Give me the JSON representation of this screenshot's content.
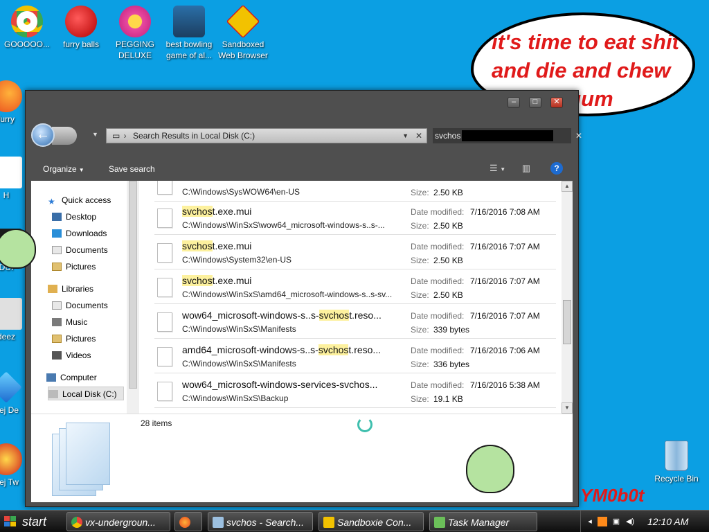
{
  "desktop_icons": [
    {
      "label": "GOOOOO...",
      "color": "#e8453c"
    },
    {
      "label": "furry balls",
      "color": "#d62020"
    },
    {
      "label": "PEGGING DELUXE",
      "color": "#e84aa0"
    },
    {
      "label": "best bowling game of al...",
      "color": "#3aa850"
    },
    {
      "label": "Sandboxed Web Browser",
      "color": "#f2c200"
    }
  ],
  "left_edge_labels": [
    "furry",
    "H",
    "DUI",
    "deez",
    "Bej De",
    "Bej Tw"
  ],
  "speech_bubble": {
    "text": "it's time to eat shit and die and chew bubble gum"
  },
  "explorer": {
    "title_buttons": {
      "minimize": "–",
      "maximize": "□",
      "close": "✕"
    },
    "address_path": "Search Results in Local Disk (C:)",
    "search_value": "svchos",
    "toolbar": {
      "organize": "Organize",
      "save_search": "Save search"
    },
    "nav_pane": {
      "quick_access": "Quick access",
      "quick_items": [
        "Desktop",
        "Downloads",
        "Documents",
        "Pictures"
      ],
      "libraries": "Libraries",
      "library_items": [
        "Documents",
        "Music",
        "Pictures",
        "Videos"
      ],
      "computer": "Computer",
      "local_disk": "Local Disk (C:)"
    },
    "results": [
      {
        "name_pre": "",
        "name_hl": "",
        "name_post": "",
        "path": "C:\\Windows\\SysWOW64\\en-US",
        "date_label": "",
        "date": "",
        "size_label": "Size:",
        "size": "2.50 KB"
      },
      {
        "name_pre": "",
        "name_hl": "svchos",
        "name_post": "t.exe.mui",
        "path": "C:\\Windows\\WinSxS\\wow64_microsoft-windows-s..s-...",
        "date_label": "Date modified:",
        "date": "7/16/2016 7:08 AM",
        "size_label": "Size:",
        "size": "2.50 KB"
      },
      {
        "name_pre": "",
        "name_hl": "svchos",
        "name_post": "t.exe.mui",
        "path": "C:\\Windows\\System32\\en-US",
        "date_label": "Date modified:",
        "date": "7/16/2016 7:07 AM",
        "size_label": "Size:",
        "size": "2.50 KB"
      },
      {
        "name_pre": "",
        "name_hl": "svchos",
        "name_post": "t.exe.mui",
        "path": "C:\\Windows\\WinSxS\\amd64_microsoft-windows-s..s-sv...",
        "date_label": "Date modified:",
        "date": "7/16/2016 7:07 AM",
        "size_label": "Size:",
        "size": "2.50 KB"
      },
      {
        "name_pre": "wow64_microsoft-windows-s..s-",
        "name_hl": "svchos",
        "name_post": "t.reso...",
        "path": "C:\\Windows\\WinSxS\\Manifests",
        "date_label": "Date modified:",
        "date": "7/16/2016 7:07 AM",
        "size_label": "Size:",
        "size": "339 bytes"
      },
      {
        "name_pre": "amd64_microsoft-windows-s..s-",
        "name_hl": "svchos",
        "name_post": "t.reso...",
        "path": "C:\\Windows\\WinSxS\\Manifests",
        "date_label": "Date modified:",
        "date": "7/16/2016 7:06 AM",
        "size_label": "Size:",
        "size": "336 bytes"
      },
      {
        "name_pre": "wow64_microsoft-windows-services-svchos...",
        "name_hl": "",
        "name_post": "",
        "path": "C:\\Windows\\WinSxS\\Backup",
        "date_label": "Date modified:",
        "date": "7/16/2016 5:38 AM",
        "size_label": "Size:",
        "size": "19.1 KB"
      }
    ],
    "item_count": "28 items"
  },
  "watermark_text": "YM0b0t",
  "recycle_bin": "Recycle Bin",
  "taskbar": {
    "start": "start",
    "buttons": [
      {
        "label": "vx-undergroun...",
        "color": "#e8453c"
      },
      {
        "label": "",
        "color": "#ff7a1a"
      },
      {
        "label": "svchos - Search...",
        "color": "#9cc0e0"
      },
      {
        "label": "Sandboxie Con...",
        "color": "#f2c200"
      },
      {
        "label": "Task Manager",
        "color": "#6bbf59"
      }
    ],
    "clock": "12:10 AM"
  }
}
